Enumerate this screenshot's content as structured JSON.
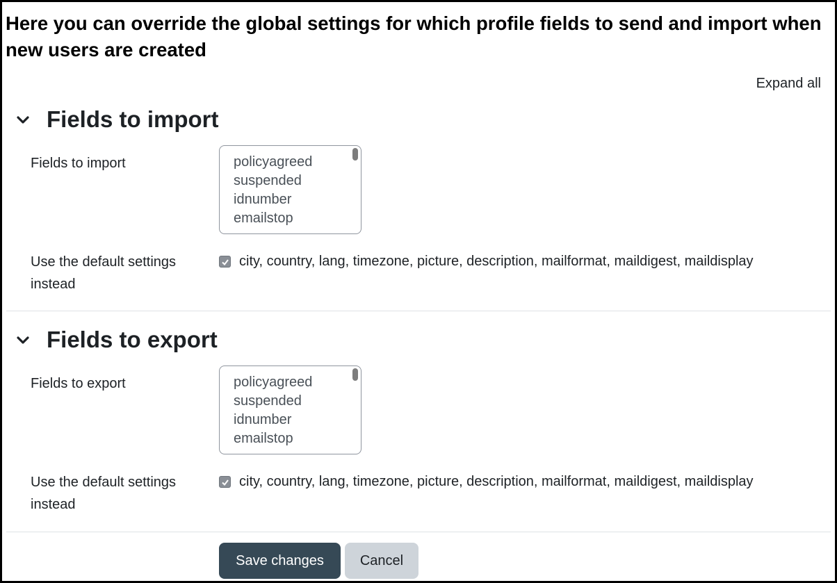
{
  "page": {
    "heading": "Here you can override the global settings for which profile fields to send and import when new users are created",
    "expand_all": "Expand all"
  },
  "import_section": {
    "title": "Fields to import",
    "field_label": "Fields to import",
    "options": [
      "policyagreed",
      "suspended",
      "idnumber",
      "emailstop"
    ],
    "default_label": "Use the default settings instead",
    "default_checked": true,
    "default_value": "city, country, lang, timezone, picture, description, mailformat, maildigest, maildisplay"
  },
  "export_section": {
    "title": "Fields to export",
    "field_label": "Fields to export",
    "options": [
      "policyagreed",
      "suspended",
      "idnumber",
      "emailstop"
    ],
    "default_label": "Use the default settings instead",
    "default_checked": true,
    "default_value": "city, country, lang, timezone, picture, description, mailformat, maildigest, maildisplay"
  },
  "buttons": {
    "save": "Save changes",
    "cancel": "Cancel"
  },
  "icons": {
    "section_toggle": "chevron-down-icon",
    "checkbox_mark": "checkmark-icon"
  },
  "colors": {
    "primary_button": "#364956",
    "secondary_button": "#ced4da",
    "checkbox": "#8a8f96"
  }
}
